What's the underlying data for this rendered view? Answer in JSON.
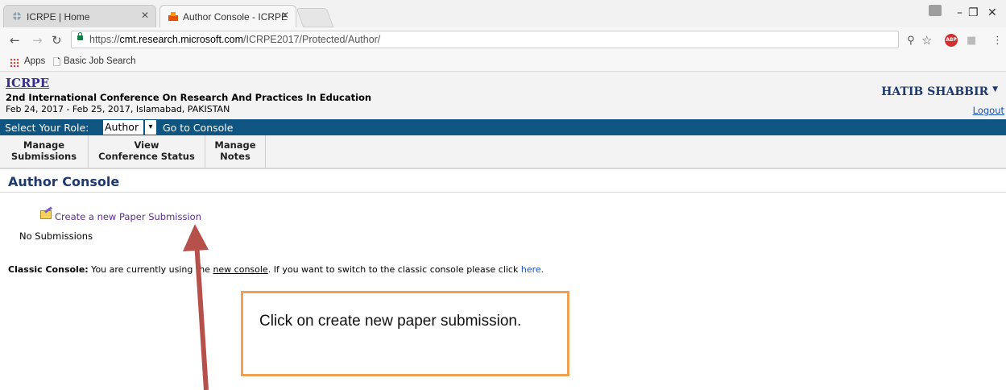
{
  "browser": {
    "tabs": [
      {
        "title": "ICRPE | Home",
        "active": false
      },
      {
        "title": "Author Console - ICRPE",
        "active": true
      }
    ],
    "url_prefix": "https://",
    "url_host": "cmt.research.microsoft.com",
    "url_path": "/ICRPE2017/Protected/Author/",
    "bookmarks": [
      "Apps",
      "Basic Job Search"
    ],
    "adblock_label": "ABP"
  },
  "header": {
    "conf_short": "ICRPE",
    "conf_name": "2nd International Conference On Research And Practices In Education",
    "conf_dates": "Feb 24, 2017 - Feb 25, 2017, Islamabad, PAKISTAN",
    "user_name": "HATIB SHABBIR",
    "logout": "Logout"
  },
  "role_bar": {
    "label": "Select Your Role:",
    "selected_role": "Author",
    "go_console": "Go to Console"
  },
  "menu": [
    {
      "line1": "Manage",
      "line2": "Submissions"
    },
    {
      "line1": "View",
      "line2": "Conference Status"
    },
    {
      "line1": "Manage",
      "line2": "Notes"
    }
  ],
  "main": {
    "title": "Author Console",
    "create_link": "Create a new Paper Submission",
    "no_submissions": "No Submissions",
    "classic_label": "Classic Console:",
    "classic_text_1": " You are currently using the ",
    "classic_link_1": "new console",
    "classic_text_2": ". If you want to switch to the classic console please click ",
    "classic_link_2": "here",
    "classic_text_3": "."
  },
  "annotation": {
    "text": "Click on create new paper submission.",
    "box_border_color": "#f0a050",
    "arrow_color": "#b5504a"
  }
}
